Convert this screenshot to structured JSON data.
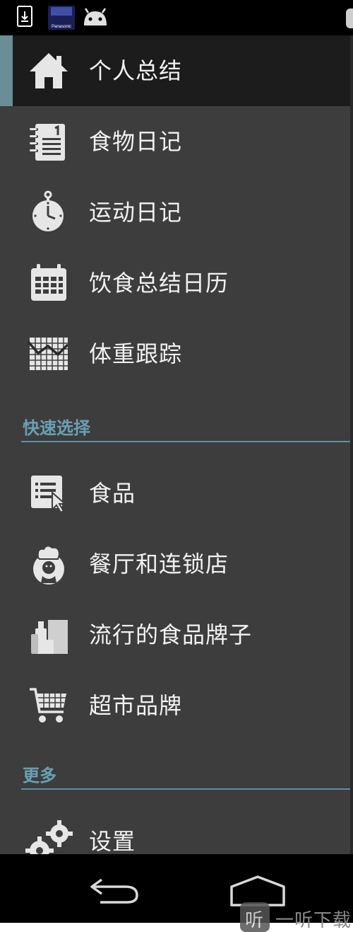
{
  "status_bar": {
    "icons": [
      "download-icon",
      "panasonic-app-icon",
      "android-icon"
    ],
    "panasonic_label": "Panasonic"
  },
  "menu": {
    "main_items": [
      {
        "label": "个人总结",
        "icon": "home-icon",
        "active": true
      },
      {
        "label": "食物日记",
        "icon": "notebook-icon"
      },
      {
        "label": "运动日记",
        "icon": "stopwatch-icon"
      },
      {
        "label": "饮食总结日历",
        "icon": "calendar-icon"
      },
      {
        "label": "体重跟踪",
        "icon": "weight-chart-icon"
      }
    ],
    "quick_select": {
      "title": "快速选择",
      "items": [
        {
          "label": "食品",
          "icon": "food-list-icon"
        },
        {
          "label": "餐厅和连锁店",
          "icon": "chef-icon"
        },
        {
          "label": "流行的食品牌子",
          "icon": "grocery-bag-icon"
        },
        {
          "label": "超市品牌",
          "icon": "shopping-cart-icon"
        }
      ]
    },
    "more": {
      "title": "更多",
      "items": [
        {
          "label": "设置",
          "icon": "gears-icon"
        }
      ]
    }
  },
  "nav_bar": {
    "buttons": [
      "back-icon",
      "home-nav-icon"
    ]
  },
  "watermark": {
    "logo_char": "听",
    "text": "一听下载"
  },
  "colors": {
    "drawer_bg": "#3d3d3d",
    "active_bg": "#1c1c1c",
    "accent": "#6a8e96",
    "section_text": "#6aa0b3"
  }
}
